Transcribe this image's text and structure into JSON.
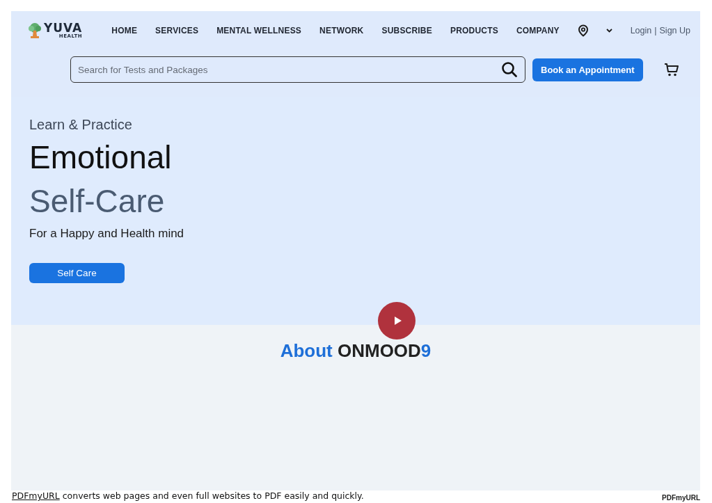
{
  "logo": {
    "name": "YUVA",
    "tagline": "HEALTH"
  },
  "nav": [
    "HOME",
    "SERVICES",
    "MENTAL WELLNESS",
    "NETWORK",
    "SUBSCRIBE",
    "PRODUCTS",
    "COMPANY"
  ],
  "auth": {
    "login": "Login",
    "separator": "|",
    "signup": "Sign Up"
  },
  "search": {
    "placeholder": "Search for Tests and Packages"
  },
  "book_button": "Book an Appointment",
  "hero": {
    "eyebrow": "Learn & Practice",
    "title_line_1": "Emotional",
    "title_line_2": "Self-Care",
    "subtitle": "For a Happy and Health mind",
    "button": "Self Care"
  },
  "about_title": [
    {
      "text": "About ",
      "kind": "accent"
    },
    {
      "text": "ONMOOD",
      "kind": "plain"
    },
    {
      "text": "9",
      "kind": "accent"
    }
  ],
  "footer": {
    "link": "PDFmyURL",
    "text": " converts web pages and even full websites to PDF easily and quickly.",
    "badge": "PDFmyURL"
  }
}
